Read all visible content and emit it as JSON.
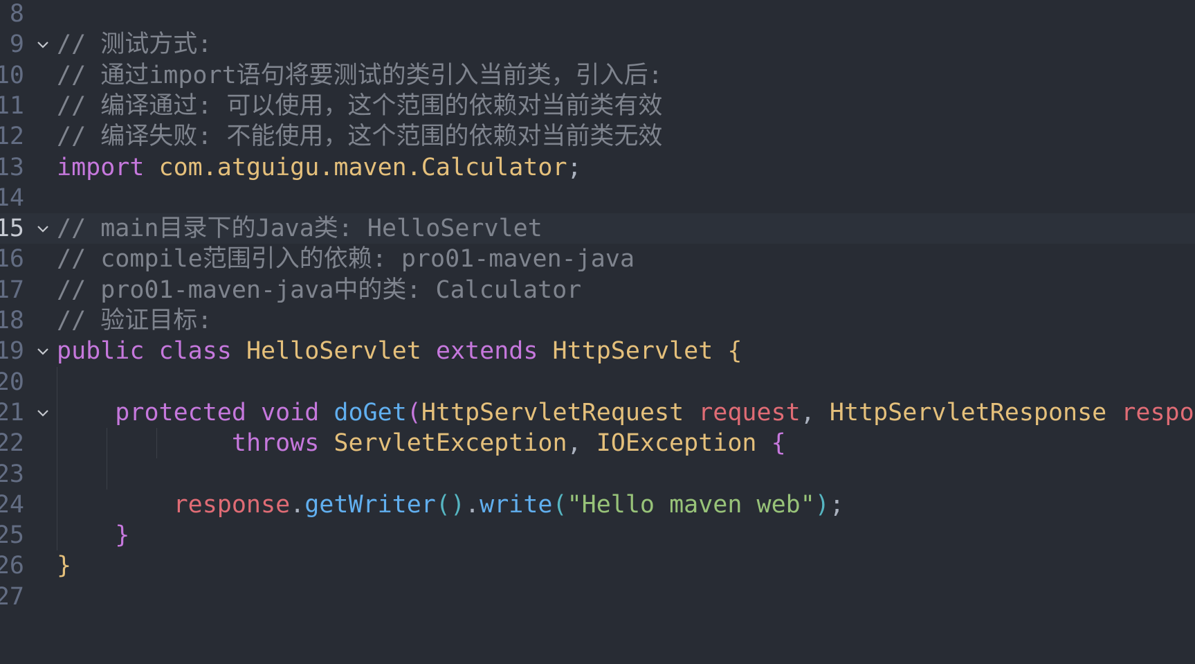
{
  "editor": {
    "theme_colors": {
      "background": "#282c34",
      "comment": "#7f848e",
      "keyword": "#c678dd",
      "type": "#e5c07b",
      "function": "#61afef",
      "parameter": "#e06c75",
      "string": "#98c379"
    },
    "lines": [
      {
        "n": "8"
      },
      {
        "n": "9",
        "fold": true,
        "tokens": [
          {
            "c": "c-com",
            "t": "// 测试方式:"
          }
        ]
      },
      {
        "n": "10",
        "tokens": [
          {
            "c": "c-com",
            "t": "// 通过import语句将要测试的类引入当前类，引入后:"
          }
        ]
      },
      {
        "n": "11",
        "tokens": [
          {
            "c": "c-com",
            "t": "// 编译通过: 可以使用，这个范围的依赖对当前类有效"
          }
        ]
      },
      {
        "n": "12",
        "tokens": [
          {
            "c": "c-com",
            "t": "// 编译失败: 不能使用，这个范围的依赖对当前类无效"
          }
        ]
      },
      {
        "n": "13",
        "tokens": [
          {
            "c": "c-kw",
            "t": "import"
          },
          {
            "c": "c-txt",
            "t": " "
          },
          {
            "c": "c-ty",
            "t": "com.atguigu.maven.Calculator"
          },
          {
            "c": "c-txt",
            "t": ";"
          }
        ]
      },
      {
        "n": "14"
      },
      {
        "n": "15",
        "fold": true,
        "active": true,
        "tokens": [
          {
            "c": "c-com",
            "t": "// main目录下的Java类: HelloServlet"
          }
        ]
      },
      {
        "n": "16",
        "tokens": [
          {
            "c": "c-com",
            "t": "// compile范围引入的依赖: pro01-maven-java"
          }
        ]
      },
      {
        "n": "17",
        "tokens": [
          {
            "c": "c-com",
            "t": "// pro01-maven-java中的类: Calculator"
          }
        ]
      },
      {
        "n": "18",
        "tokens": [
          {
            "c": "c-com",
            "t": "// 验证目标:"
          }
        ]
      },
      {
        "n": "19",
        "fold": true,
        "tokens": [
          {
            "c": "c-kw",
            "t": "public"
          },
          {
            "c": "c-txt",
            "t": " "
          },
          {
            "c": "c-kw",
            "t": "class"
          },
          {
            "c": "c-txt",
            "t": " "
          },
          {
            "c": "c-ty",
            "t": "HelloServlet"
          },
          {
            "c": "c-txt",
            "t": " "
          },
          {
            "c": "c-kw",
            "t": "extends"
          },
          {
            "c": "c-txt",
            "t": " "
          },
          {
            "c": "c-ty",
            "t": "HttpServlet"
          },
          {
            "c": "c-txt",
            "t": " "
          },
          {
            "c": "c-br",
            "t": "{"
          }
        ]
      },
      {
        "n": "20"
      },
      {
        "n": "21",
        "fold": true,
        "tokens": [
          {
            "c": "c-txt",
            "t": "    "
          },
          {
            "c": "c-kw",
            "t": "protected"
          },
          {
            "c": "c-txt",
            "t": " "
          },
          {
            "c": "c-kw",
            "t": "void"
          },
          {
            "c": "c-txt",
            "t": " "
          },
          {
            "c": "c-fn",
            "t": "doGet"
          },
          {
            "c": "c-bp",
            "t": "("
          },
          {
            "c": "c-ty",
            "t": "HttpServletRequest"
          },
          {
            "c": "c-txt",
            "t": " "
          },
          {
            "c": "c-par",
            "t": "request"
          },
          {
            "c": "c-txt",
            "t": ", "
          },
          {
            "c": "c-ty",
            "t": "HttpServletResponse"
          },
          {
            "c": "c-txt",
            "t": " "
          },
          {
            "c": "c-par",
            "t": "response"
          },
          {
            "c": "c-bp",
            "t": ")"
          }
        ]
      },
      {
        "n": "22",
        "tokens": [
          {
            "c": "c-txt",
            "t": "            "
          },
          {
            "c": "c-kw",
            "t": "throws"
          },
          {
            "c": "c-txt",
            "t": " "
          },
          {
            "c": "c-ty",
            "t": "ServletException"
          },
          {
            "c": "c-txt",
            "t": ", "
          },
          {
            "c": "c-ty",
            "t": "IOException"
          },
          {
            "c": "c-txt",
            "t": " "
          },
          {
            "c": "c-bp",
            "t": "{"
          }
        ]
      },
      {
        "n": "23"
      },
      {
        "n": "24",
        "tokens": [
          {
            "c": "c-txt",
            "t": "        "
          },
          {
            "c": "c-par",
            "t": "response"
          },
          {
            "c": "c-txt",
            "t": "."
          },
          {
            "c": "c-fn",
            "t": "getWriter"
          },
          {
            "c": "c-bb",
            "t": "()"
          },
          {
            "c": "c-txt",
            "t": "."
          },
          {
            "c": "c-fn",
            "t": "write"
          },
          {
            "c": "c-bb",
            "t": "("
          },
          {
            "c": "c-str",
            "t": "\"Hello maven web\""
          },
          {
            "c": "c-bb",
            "t": ")"
          },
          {
            "c": "c-txt",
            "t": ";"
          }
        ]
      },
      {
        "n": "25",
        "tokens": [
          {
            "c": "c-txt",
            "t": "    "
          },
          {
            "c": "c-bp",
            "t": "}"
          }
        ]
      },
      {
        "n": "26",
        "tokens": [
          {
            "c": "c-br",
            "t": "}"
          }
        ]
      },
      {
        "n": "27"
      }
    ]
  }
}
